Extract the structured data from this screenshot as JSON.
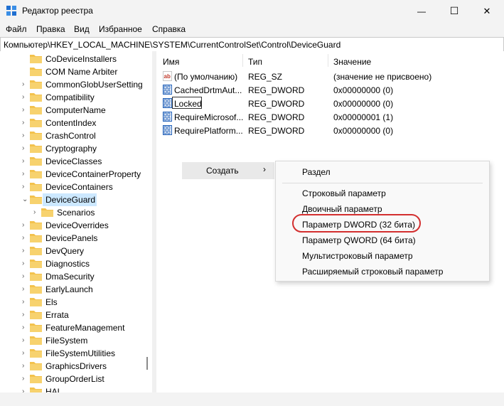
{
  "window": {
    "title": "Редактор реестра",
    "minimize_glyph": "—",
    "maximize_glyph": "☐",
    "close_glyph": "✕"
  },
  "menu": [
    "Файл",
    "Правка",
    "Вид",
    "Избранное",
    "Справка"
  ],
  "address": "Компьютер\\HKEY_LOCAL_MACHINE\\SYSTEM\\CurrentControlSet\\Control\\DeviceGuard",
  "tree": {
    "items": [
      {
        "label": "CoDeviceInstallers",
        "expandable": false
      },
      {
        "label": "COM Name Arbiter",
        "expandable": false
      },
      {
        "label": "CommonGlobUserSettings",
        "expandable": true
      },
      {
        "label": "Compatibility",
        "expandable": true
      },
      {
        "label": "ComputerName",
        "expandable": true
      },
      {
        "label": "ContentIndex",
        "expandable": true
      },
      {
        "label": "CrashControl",
        "expandable": true
      },
      {
        "label": "Cryptography",
        "expandable": true
      },
      {
        "label": "DeviceClasses",
        "expandable": true
      },
      {
        "label": "DeviceContainerProperty",
        "expandable": true
      },
      {
        "label": "DeviceContainers",
        "expandable": true
      },
      {
        "label": "DeviceGuard",
        "expandable": true,
        "expanded": true,
        "selected": true
      },
      {
        "label": "Scenarios",
        "expandable": true,
        "child": true
      },
      {
        "label": "DeviceOverrides",
        "expandable": true
      },
      {
        "label": "DevicePanels",
        "expandable": true
      },
      {
        "label": "DevQuery",
        "expandable": true
      },
      {
        "label": "Diagnostics",
        "expandable": true
      },
      {
        "label": "DmaSecurity",
        "expandable": true
      },
      {
        "label": "EarlyLaunch",
        "expandable": true
      },
      {
        "label": "Els",
        "expandable": true
      },
      {
        "label": "Errata",
        "expandable": true
      },
      {
        "label": "FeatureManagement",
        "expandable": true
      },
      {
        "label": "FileSystem",
        "expandable": true
      },
      {
        "label": "FileSystemUtilities",
        "expandable": true
      },
      {
        "label": "GraphicsDrivers",
        "expandable": true
      },
      {
        "label": "GroupOrderList",
        "expandable": true
      },
      {
        "label": "HAL",
        "expandable": true
      }
    ]
  },
  "list": {
    "columns": [
      "Имя",
      "Тип",
      "Значение"
    ],
    "rows": [
      {
        "icon": "string-value-icon",
        "name": "(По умолчанию)",
        "type": "REG_SZ",
        "data": "(значение не присвоено)"
      },
      {
        "icon": "binary-value-icon",
        "name": "CachedDrtmAut...",
        "type": "REG_DWORD",
        "data": "0x00000000 (0)"
      },
      {
        "icon": "binary-value-icon",
        "name": "Locked",
        "type": "REG_DWORD",
        "data": "0x00000000 (0)"
      },
      {
        "icon": "binary-value-icon",
        "name": "RequireMicrosof...",
        "type": "REG_DWORD",
        "data": "0x00000001 (1)"
      },
      {
        "icon": "binary-value-icon",
        "name": "RequirePlatform...",
        "type": "REG_DWORD",
        "data": "0x00000000 (0)"
      }
    ]
  },
  "context_menu": {
    "create_label": "Создать",
    "arrow": "›",
    "submenu": {
      "section": "Раздел",
      "items": [
        "Строковый параметр",
        "Двоичный параметр",
        "Параметр DWORD (32 бита)",
        "Параметр QWORD (64 бита)",
        "Мультистроковый параметр",
        "Расширяемый строковый параметр"
      ]
    }
  },
  "colors": {
    "selection": "#cce8ff",
    "folder": "#f3c24d",
    "highlight_ring": "#d32f2f",
    "hover": "#e9e9e9"
  }
}
